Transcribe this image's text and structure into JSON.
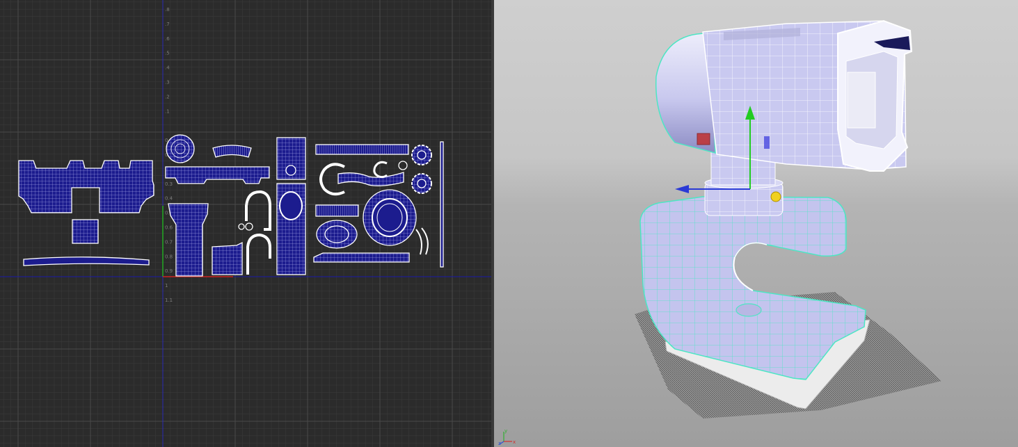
{
  "uv_editor": {
    "background": "#2b2b2b",
    "grid_minor_color": "#3a3a3a",
    "grid_major_color": "#4a4a4a",
    "u_axis_color": "#1a1aa8",
    "v_axis_color": "#2a2ab5",
    "shell_fill": "#1c1c8e",
    "shell_stroke": "#ffffff",
    "v_tick_labels": [
      ".8",
      ".7",
      ".6",
      ".5",
      ".4",
      ".3",
      ".2",
      ".1",
      "",
      "0",
      "0.1",
      "0.2",
      "0.3",
      "0.4",
      "0.5",
      "0.6",
      "0.7",
      "0.8",
      "0.9",
      "1",
      "1.1"
    ]
  },
  "viewport": {
    "background_top": "#cfcfcf",
    "background_bottom": "#9e9e9e",
    "mesh_fill": "#c9c9f0",
    "wire_color": "#ffffff",
    "selection_wire_color": "#4de6c4",
    "manipulator": {
      "y_color": "#22cc22",
      "x_color": "#2a3ad6",
      "z_color": "#c03030",
      "center_color": "#f0d020"
    },
    "view_axis": {
      "x_label": "x",
      "y_label": "y",
      "z_label": "z",
      "x_color": "#d03030",
      "y_color": "#30b030",
      "z_color": "#3050d0"
    }
  }
}
